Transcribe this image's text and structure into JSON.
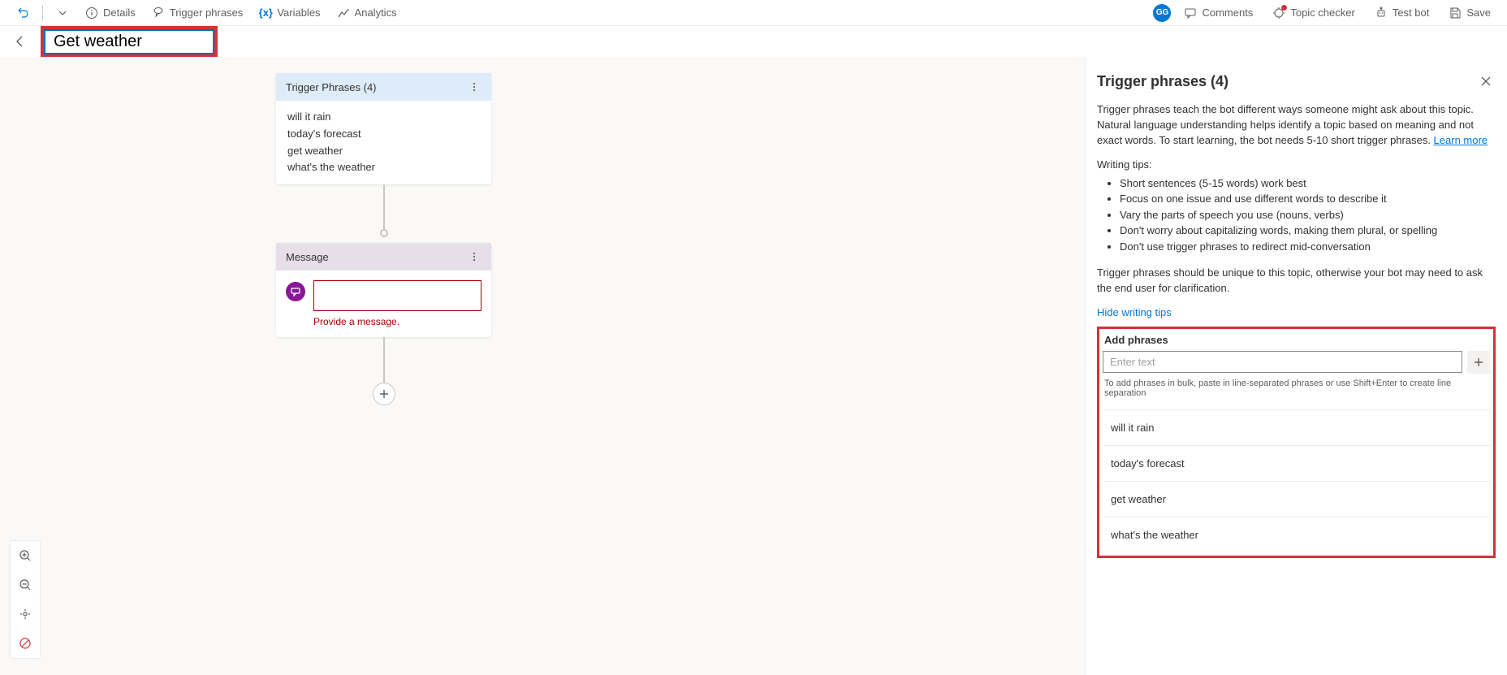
{
  "toolbar": {
    "details": "Details",
    "triggerPhrases": "Trigger phrases",
    "variables": "Variables",
    "analytics": "Analytics",
    "comments": "Comments",
    "topicChecker": "Topic checker",
    "testBot": "Test bot",
    "save": "Save",
    "avatar": "GG"
  },
  "title": {
    "value": "Get weather"
  },
  "canvas": {
    "triggerHeader": "Trigger Phrases (4)",
    "phrases": [
      "will it rain",
      "today's forecast",
      "get weather",
      "what's the weather"
    ],
    "messageHeader": "Message",
    "messageError": "Provide a message."
  },
  "panel": {
    "title": "Trigger phrases (4)",
    "intro": "Trigger phrases teach the bot different ways someone might ask about this topic. Natural language understanding helps identify a topic based on meaning and not exact words. To start learning, the bot needs 5-10 short trigger phrases. ",
    "learnMore": "Learn more",
    "tipsTitle": "Writing tips:",
    "tips": [
      "Short sentences (5-15 words) work best",
      "Focus on one issue and use different words to describe it",
      "Vary the parts of speech you use (nouns, verbs)",
      "Don't worry about capitalizing words, making them plural, or spelling",
      "Don't use trigger phrases to redirect mid-conversation"
    ],
    "unique": "Trigger phrases should be unique to this topic, otherwise your bot may need to ask the end user for clarification.",
    "hideTips": "Hide writing tips",
    "addLabel": "Add phrases",
    "addPlaceholder": "Enter text",
    "addHint": "To add phrases in bulk, paste in line-separated phrases or use Shift+Enter to create line separation",
    "phrases": [
      "will it rain",
      "today's forecast",
      "get weather",
      "what's the weather"
    ]
  }
}
